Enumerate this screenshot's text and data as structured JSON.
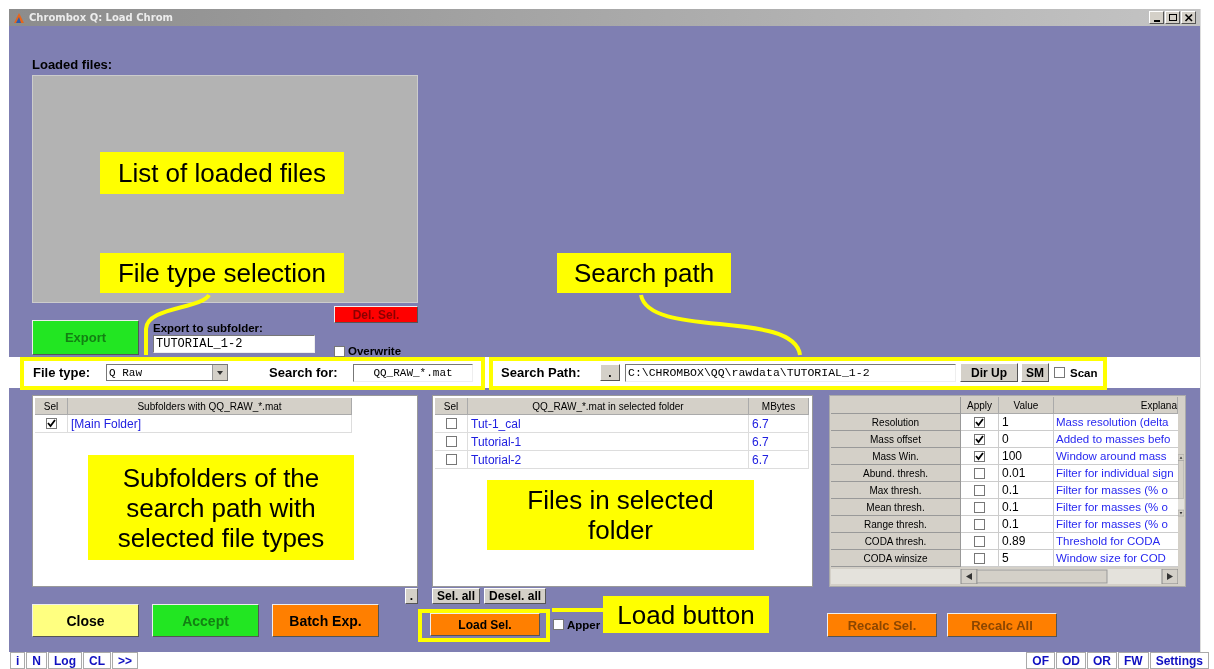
{
  "window": {
    "title": "Chrombox Q: Load Chrom"
  },
  "loaded_files": {
    "label": "Loaded files:"
  },
  "export": {
    "button": {
      "label": "Export",
      "color": "#22e622",
      "disabled": true
    },
    "subfolder_label": "Export to subfolder:",
    "subfolder_value": "TUTORIAL_1-2",
    "delete_button": {
      "label": "Del. Sel.",
      "color": "#ff0000",
      "disabled": true
    },
    "overwrite": {
      "label": "Overwrite",
      "checked": false
    }
  },
  "search_bar": {
    "file_type_label": "File type:",
    "file_type_value": "Q Raw",
    "search_for_label": "Search for:",
    "search_for_value": "QQ_RAW_*.mat",
    "search_path_label": "Search Path:",
    "dot_button": ".",
    "path_value": "C:\\CHROMBOX\\QQ\\rawdata\\TUTORIAL_1-2",
    "dir_up_button": "Dir Up",
    "sm_button": "SM",
    "scan": {
      "label": "Scan",
      "checked": false
    }
  },
  "subfolders_table": {
    "columns": [
      "Sel",
      "Subfolders with QQ_RAW_*.mat"
    ],
    "rows": [
      {
        "checked": true,
        "name": "[Main Folder]"
      }
    ]
  },
  "files_table": {
    "columns": [
      "Sel",
      "QQ_RAW_*.mat in selected folder",
      "MBytes"
    ],
    "rows": [
      {
        "checked": false,
        "name": "Tut-1_cal",
        "size": "6.7"
      },
      {
        "checked": false,
        "name": "Tutorial-1",
        "size": "6.7"
      },
      {
        "checked": false,
        "name": "Tutorial-2",
        "size": "6.7"
      }
    ]
  },
  "params_table": {
    "columns": [
      "Apply",
      "Value",
      "Explana"
    ],
    "rows": [
      {
        "name": "Resolution",
        "checked": true,
        "value": "1",
        "explanation": "Mass resolution (delta"
      },
      {
        "name": "Mass offset",
        "checked": true,
        "value": "0",
        "explanation": "Added to masses befo"
      },
      {
        "name": "Mass Win.",
        "checked": true,
        "value": "100",
        "explanation": "Window around mass"
      },
      {
        "name": "Abund. thresh.",
        "checked": false,
        "value": "0.01",
        "explanation": "Filter for individual sign"
      },
      {
        "name": "Max thresh.",
        "checked": false,
        "value": "0.1",
        "explanation": "Filter for masses (% o"
      },
      {
        "name": "Mean thresh.",
        "checked": false,
        "value": "0.1",
        "explanation": "Filter for masses (% o"
      },
      {
        "name": "Range thresh.",
        "checked": false,
        "value": "0.1",
        "explanation": "Filter for masses (% o"
      },
      {
        "name": "CODA thresh.",
        "checked": false,
        "value": "0.89",
        "explanation": "Threshold for CODA"
      },
      {
        "name": "CODA winsize",
        "checked": false,
        "value": "5",
        "explanation": "Window size for COD"
      }
    ]
  },
  "folder_dot_button": ".",
  "selection_buttons": [
    "Sel. all",
    "Desel. all"
  ],
  "main_buttons": [
    {
      "label": "Close",
      "color": "#ffff80",
      "disabled": false
    },
    {
      "label": "Accept",
      "color": "#22e622",
      "disabled": true
    },
    {
      "label": "Batch Exp.",
      "color": "#ff7f00",
      "disabled": false
    }
  ],
  "load": {
    "button": {
      "label": "Load Sel.",
      "color": "#ff7f00",
      "disabled": false
    },
    "append": {
      "label": "Apper",
      "checked": false
    }
  },
  "recalc_buttons": [
    {
      "label": "Recalc Sel.",
      "color": "#ff7f00",
      "disabled": true
    },
    {
      "label": "Recalc All",
      "color": "#ff7f00",
      "disabled": true
    }
  ],
  "footer_left": [
    "i",
    "N",
    "Log",
    "CL",
    ">>"
  ],
  "footer_right": [
    "OF",
    "OD",
    "OR",
    "FW",
    "Settings"
  ],
  "annotations": [
    {
      "text": "List of loaded files"
    },
    {
      "text": "File type selection"
    },
    {
      "text": "Search path"
    },
    {
      "text": "Subfolders of the search path with selected file types"
    },
    {
      "text": "Files in selected folder"
    },
    {
      "text": "Load button"
    }
  ]
}
